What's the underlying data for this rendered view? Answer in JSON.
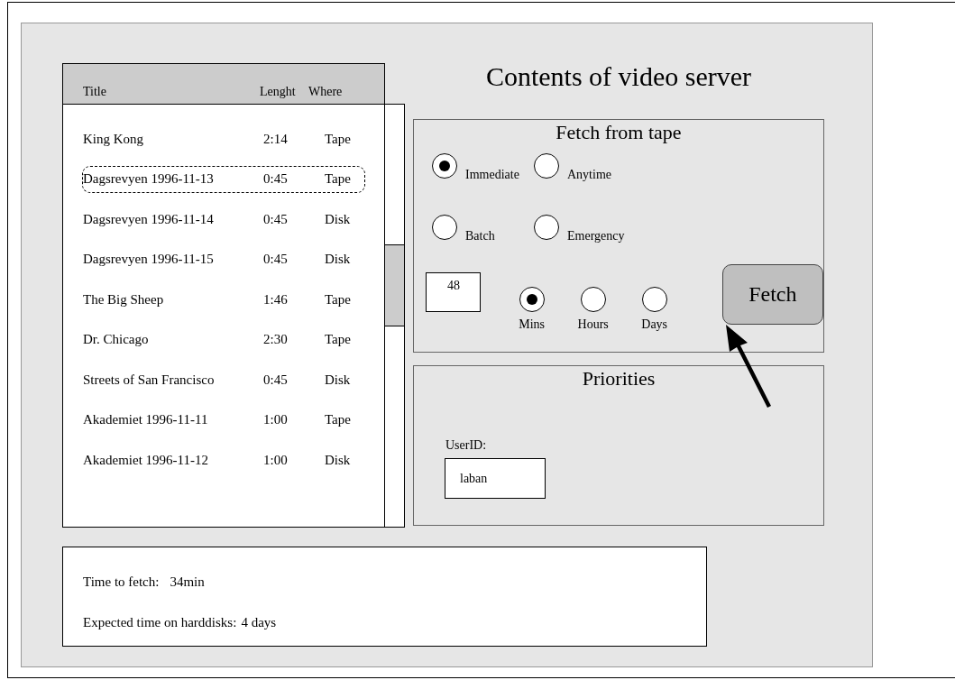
{
  "title": "Contents of video server",
  "table": {
    "columns": [
      "Title",
      "Lenght",
      "Where"
    ],
    "rows": [
      {
        "title": "King Kong",
        "length": "2:14",
        "where": "Tape",
        "selected": false
      },
      {
        "title": "Dagsrevyen 1996-11-13",
        "length": "0:45",
        "where": "Tape",
        "selected": true
      },
      {
        "title": "Dagsrevyen 1996-11-14",
        "length": "0:45",
        "where": "Disk",
        "selected": false
      },
      {
        "title": "Dagsrevyen 1996-11-15",
        "length": "0:45",
        "where": "Disk",
        "selected": false
      },
      {
        "title": "The Big Sheep",
        "length": "1:46",
        "where": "Tape",
        "selected": false
      },
      {
        "title": "Dr. Chicago",
        "length": "2:30",
        "where": "Tape",
        "selected": false
      },
      {
        "title": "Streets of San Francisco",
        "length": "0:45",
        "where": "Disk",
        "selected": false
      },
      {
        "title": "Akademiet 1996-11-11",
        "length": "1:00",
        "where": "Tape",
        "selected": false
      },
      {
        "title": "Akademiet 1996-11-12",
        "length": "1:00",
        "where": "Disk",
        "selected": false
      }
    ]
  },
  "fetch_panel": {
    "title": "Fetch from tape",
    "modes": [
      {
        "label": "Immediate",
        "selected": true
      },
      {
        "label": "Anytime",
        "selected": false
      },
      {
        "label": "Batch",
        "selected": false
      },
      {
        "label": "Emergency",
        "selected": false
      }
    ],
    "amount": {
      "value": "48"
    },
    "units": [
      {
        "label": "Mins",
        "selected": true
      },
      {
        "label": "Hours",
        "selected": false
      },
      {
        "label": "Days",
        "selected": false
      }
    ],
    "button": "Fetch"
  },
  "priorities": {
    "title": "Priorities",
    "user_id": {
      "label": "UserID:",
      "value": "laban"
    }
  },
  "status": [
    {
      "label": "Time to fetch:",
      "value": "34min"
    },
    {
      "label": "Expected time on harddisks:",
      "value": "4 days"
    }
  ]
}
